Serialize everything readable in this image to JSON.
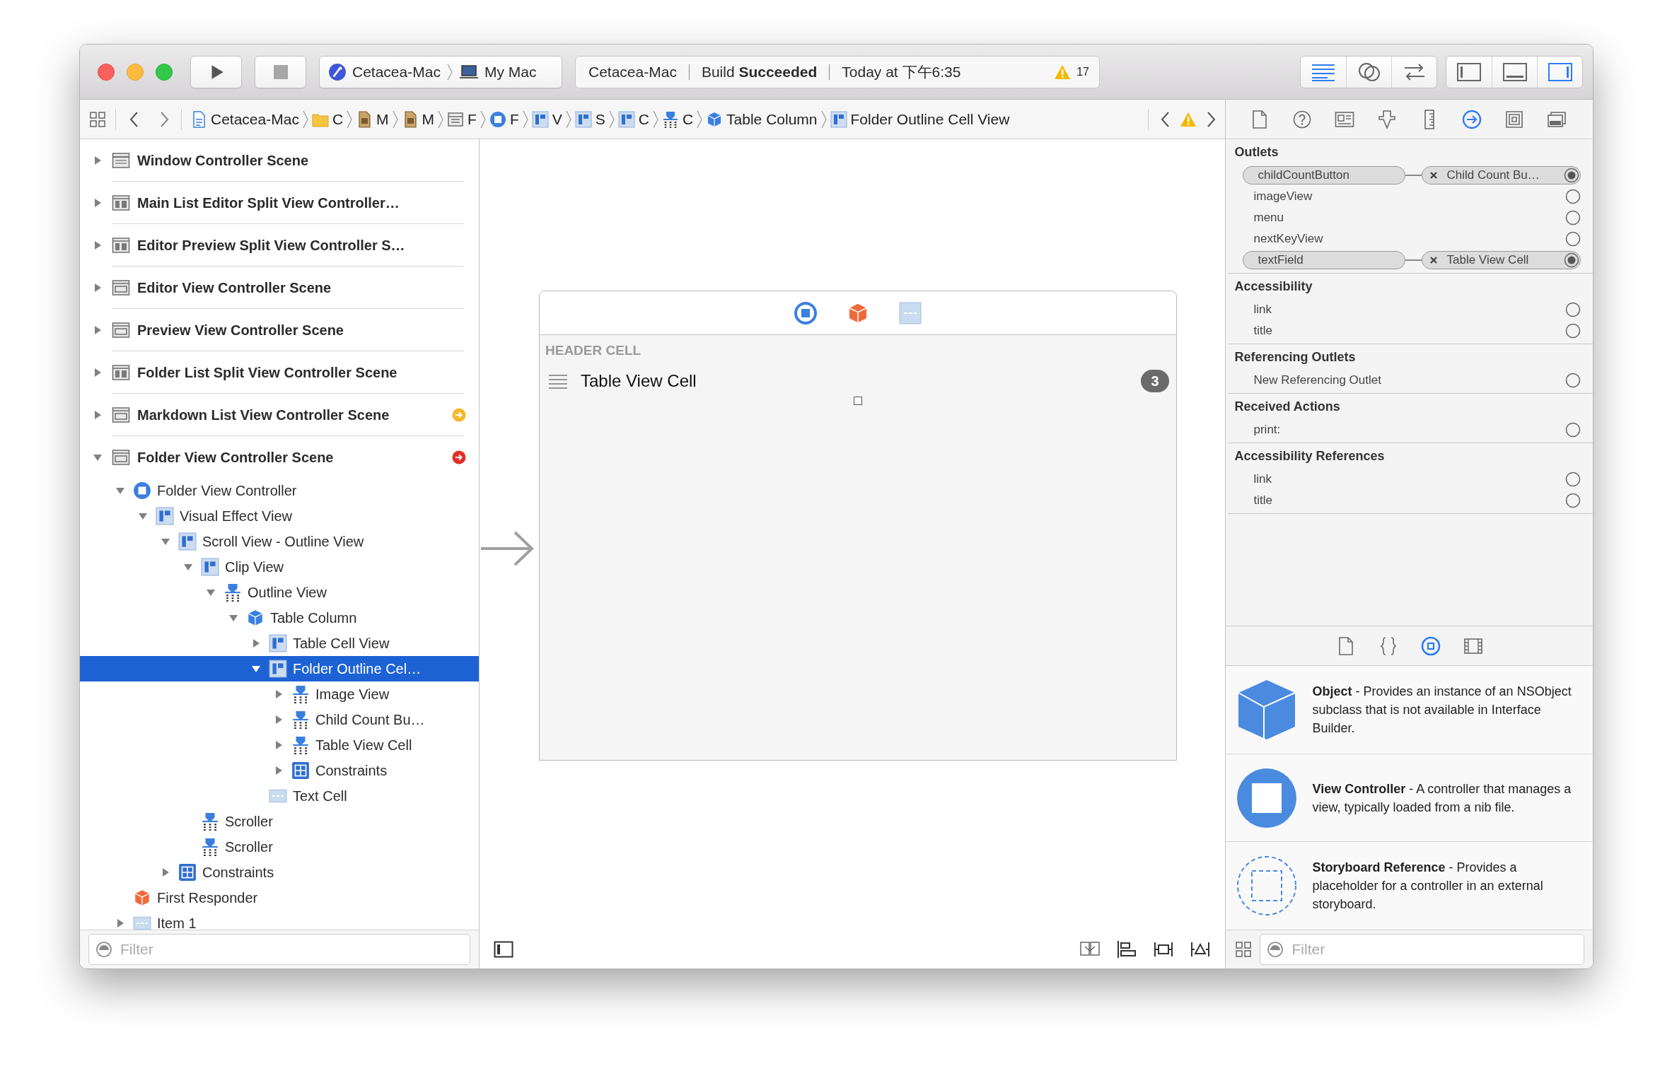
{
  "toolbar": {
    "scheme": {
      "target": "Cetacea-Mac",
      "destination": "My Mac"
    },
    "activity": {
      "project": "Cetacea-Mac",
      "status": "Build **Succeeded**",
      "time": "Today at 下午6:35",
      "warning_count": "17"
    },
    "editor_modes": [
      {
        "kind": "standard",
        "selected": true
      },
      {
        "kind": "assistant",
        "selected": false
      },
      {
        "kind": "version",
        "selected": false
      }
    ],
    "panels": [
      {
        "kind": "navigator",
        "selected": false
      },
      {
        "kind": "debug",
        "selected": false
      },
      {
        "kind": "utilities",
        "selected": true
      }
    ]
  },
  "jump_bar": {
    "items": [
      {
        "kind": "project",
        "label": "Cetacea-Mac"
      },
      {
        "kind": "folder",
        "label": "C"
      },
      {
        "kind": "storyboard",
        "label": "M"
      },
      {
        "kind": "storyboard",
        "label": "M"
      },
      {
        "kind": "scene",
        "label": "F"
      },
      {
        "kind": "controller",
        "label": "F"
      },
      {
        "kind": "view",
        "label": "V"
      },
      {
        "kind": "view",
        "label": "S"
      },
      {
        "kind": "view",
        "label": "C"
      },
      {
        "kind": "control",
        "label": "C"
      },
      {
        "kind": "column",
        "label": "Table Column"
      },
      {
        "kind": "view",
        "label": "Folder Outline Cell View"
      }
    ]
  },
  "navigator": {
    "scenes": [
      {
        "kind": "window",
        "label": "Window Controller Scene",
        "expanded": false
      },
      {
        "kind": "split",
        "label": "Main List Editor Split View Controller…",
        "expanded": false
      },
      {
        "kind": "split",
        "label": "Editor Preview Split View Controller S…",
        "expanded": false
      },
      {
        "kind": "view",
        "label": "Editor View Controller Scene",
        "expanded": false
      },
      {
        "kind": "view",
        "label": "Preview View Controller Scene",
        "expanded": false
      },
      {
        "kind": "split",
        "label": "Folder List Split View Controller Scene",
        "expanded": false
      },
      {
        "kind": "view",
        "label": "Markdown List View Controller Scene",
        "expanded": false,
        "color": "#f5b82e"
      },
      {
        "kind": "view",
        "label": "Folder View Controller Scene",
        "expanded": true,
        "color": "#e0302b",
        "children": [
          {
            "kind": "controller",
            "label": "Folder View Controller",
            "expanded": true,
            "selected": false,
            "children": [
              {
                "kind": "view",
                "label": "Visual Effect View",
                "expanded": true,
                "selected": false,
                "children": [
                  {
                    "kind": "view",
                    "label": "Scroll View - Outline View",
                    "expanded": true,
                    "selected": false,
                    "children": [
                      {
                        "kind": "view",
                        "label": "Clip View",
                        "expanded": true,
                        "selected": false,
                        "children": [
                          {
                            "kind": "control",
                            "label": "Outline View",
                            "expanded": true,
                            "selected": false,
                            "children": [
                              {
                                "kind": "column",
                                "label": "Table Column",
                                "expanded": true,
                                "selected": false,
                                "children": [
                                  {
                                    "kind": "view",
                                    "label": "Table Cell View",
                                    "expanded": false,
                                    "selected": false
                                  },
                                  {
                                    "kind": "view",
                                    "label": "Folder Outline Cel…",
                                    "expanded": true,
                                    "selected": true,
                                    "children": [
                                      {
                                        "kind": "control",
                                        "label": "Image View",
                                        "expanded": false,
                                        "selected": false
                                      },
                                      {
                                        "kind": "control",
                                        "label": "Child Count Bu…",
                                        "expanded": false,
                                        "selected": false
                                      },
                                      {
                                        "kind": "control",
                                        "label": "Table View Cell",
                                        "expanded": false,
                                        "selected": false
                                      },
                                      {
                                        "kind": "constraints",
                                        "label": "Constraints",
                                        "expanded": false,
                                        "selected": false
                                      }
                                    ]
                                  },
                                  {
                                    "kind": "cell",
                                    "label": "Text Cell",
                                    "selected": false
                                  }
                                ]
                              }
                            ]
                          }
                        ]
                      },
                      {
                        "kind": "control",
                        "label": "Scroller",
                        "selected": false
                      },
                      {
                        "kind": "control",
                        "label": "Scroller",
                        "selected": false
                      }
                    ]
                  },
                  {
                    "kind": "constraints",
                    "label": "Constraints",
                    "expanded": false,
                    "selected": false
                  }
                ]
              }
            ]
          },
          {
            "kind": "responder",
            "label": "First Responder",
            "selected": false
          },
          {
            "kind": "item",
            "label": "Item 1",
            "expanded": false,
            "selected": false
          }
        ]
      }
    ],
    "filter": {
      "placeholder": "Filter"
    }
  },
  "canvas": {
    "dock": [
      {
        "kind": "controller"
      },
      {
        "kind": "responder"
      },
      {
        "kind": "item"
      }
    ],
    "header": "HEADER CELL",
    "cell": {
      "label": "Table View Cell",
      "count": "3"
    }
  },
  "inspector": {
    "tabs": [
      {
        "kind": "file",
        "selected": false
      },
      {
        "kind": "quick_help",
        "selected": false
      },
      {
        "kind": "identity",
        "selected": false
      },
      {
        "kind": "attributes",
        "selected": false
      },
      {
        "kind": "size",
        "selected": false
      },
      {
        "kind": "connections",
        "selected": true
      },
      {
        "kind": "bindings",
        "selected": false
      },
      {
        "kind": "effects",
        "selected": false
      }
    ],
    "sections": [
      {
        "title": "Outlets",
        "rows": [
          {
            "label": "childCountButton",
            "connected": true,
            "target": "Child Count Bu…"
          },
          {
            "label": "imageView",
            "connected": false
          },
          {
            "label": "menu",
            "connected": false
          },
          {
            "label": "nextKeyView",
            "connected": false
          },
          {
            "label": "textField",
            "connected": true,
            "target": "Table View Cell"
          }
        ]
      },
      {
        "title": "Accessibility",
        "rows": [
          {
            "label": "link",
            "connected": false
          },
          {
            "label": "title",
            "connected": false
          }
        ]
      },
      {
        "title": "Referencing Outlets",
        "rows": [
          {
            "label": "New Referencing Outlet",
            "connected": false
          }
        ]
      },
      {
        "title": "Received Actions",
        "rows": [
          {
            "label": "print:",
            "connected": false
          }
        ]
      },
      {
        "title": "Accessibility References",
        "rows": [
          {
            "label": "link",
            "connected": false
          },
          {
            "label": "title",
            "connected": false
          }
        ]
      }
    ]
  },
  "library": {
    "tabs": [
      {
        "kind": "file",
        "selected": false
      },
      {
        "kind": "code",
        "selected": false
      },
      {
        "kind": "object",
        "selected": true
      },
      {
        "kind": "media",
        "selected": false
      }
    ],
    "items": [
      {
        "kind": "object",
        "text": "**Object** - Provides an instance of an NSObject subclass that is not available in Interface Builder."
      },
      {
        "kind": "controller",
        "text": "**View Controller** - A controller that manages a view, typically loaded from a nib file."
      },
      {
        "kind": "reference",
        "text": "**Storyboard Reference** - Provides a placeholder for a controller in an external storyboard."
      }
    ],
    "filter": {
      "placeholder": "Filter"
    }
  }
}
